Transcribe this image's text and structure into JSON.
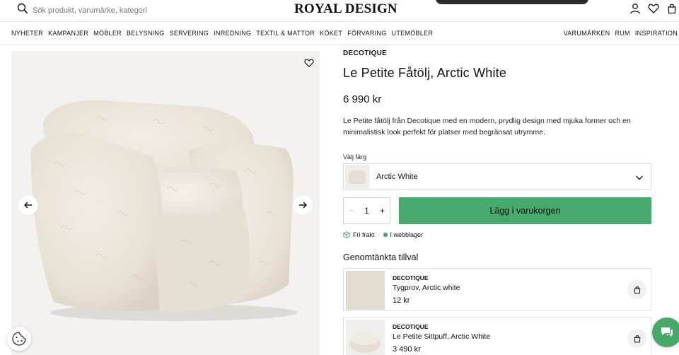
{
  "header": {
    "search_placeholder": "Sök produkt, varumärke, kategori",
    "logo": "ROYAL DESIGN",
    "icons": [
      "user-icon",
      "heart-icon",
      "bag-icon"
    ]
  },
  "nav": {
    "left": [
      "NYHETER",
      "KAMPANJER",
      "MÖBLER",
      "BELYSNING",
      "SERVERING",
      "INREDNING",
      "TEXTIL & MATTOR",
      "KÖKET",
      "FÖRVARING",
      "UTEMÖBLER"
    ],
    "right": [
      "VARUMÄRKEN",
      "RUM",
      "INSPIRATION"
    ]
  },
  "product": {
    "brand": "DECOTIQUE",
    "title": "Le Petite Fåtölj, Arctic White",
    "price": "6 990 kr",
    "description": "Le Petite fåtölj från Decotique med en modern, prydlig design med mjuka former och en minimalistisk look perfekt för platser med begränsat utrymme.",
    "color_label": "Välj färg",
    "color_value": "Arctic White",
    "quantity": "1",
    "add_to_cart": "Lägg i varukorgen",
    "usp_shipping": "Fri frakt",
    "usp_stock": "I webblager"
  },
  "recommendations": {
    "heading": "Genomtänkta tillval",
    "items": [
      {
        "brand": "DECOTIQUE",
        "name": "Tygprov, Arctic white",
        "price": "12 kr"
      },
      {
        "brand": "DECOTIQUE",
        "name": "Le Petite Sittpuff, Arctic White",
        "price": "3 490 kr"
      }
    ]
  },
  "colors": {
    "accent": "#47a96c",
    "chat": "#46a96a",
    "image_bg": "#f3f2f0"
  }
}
